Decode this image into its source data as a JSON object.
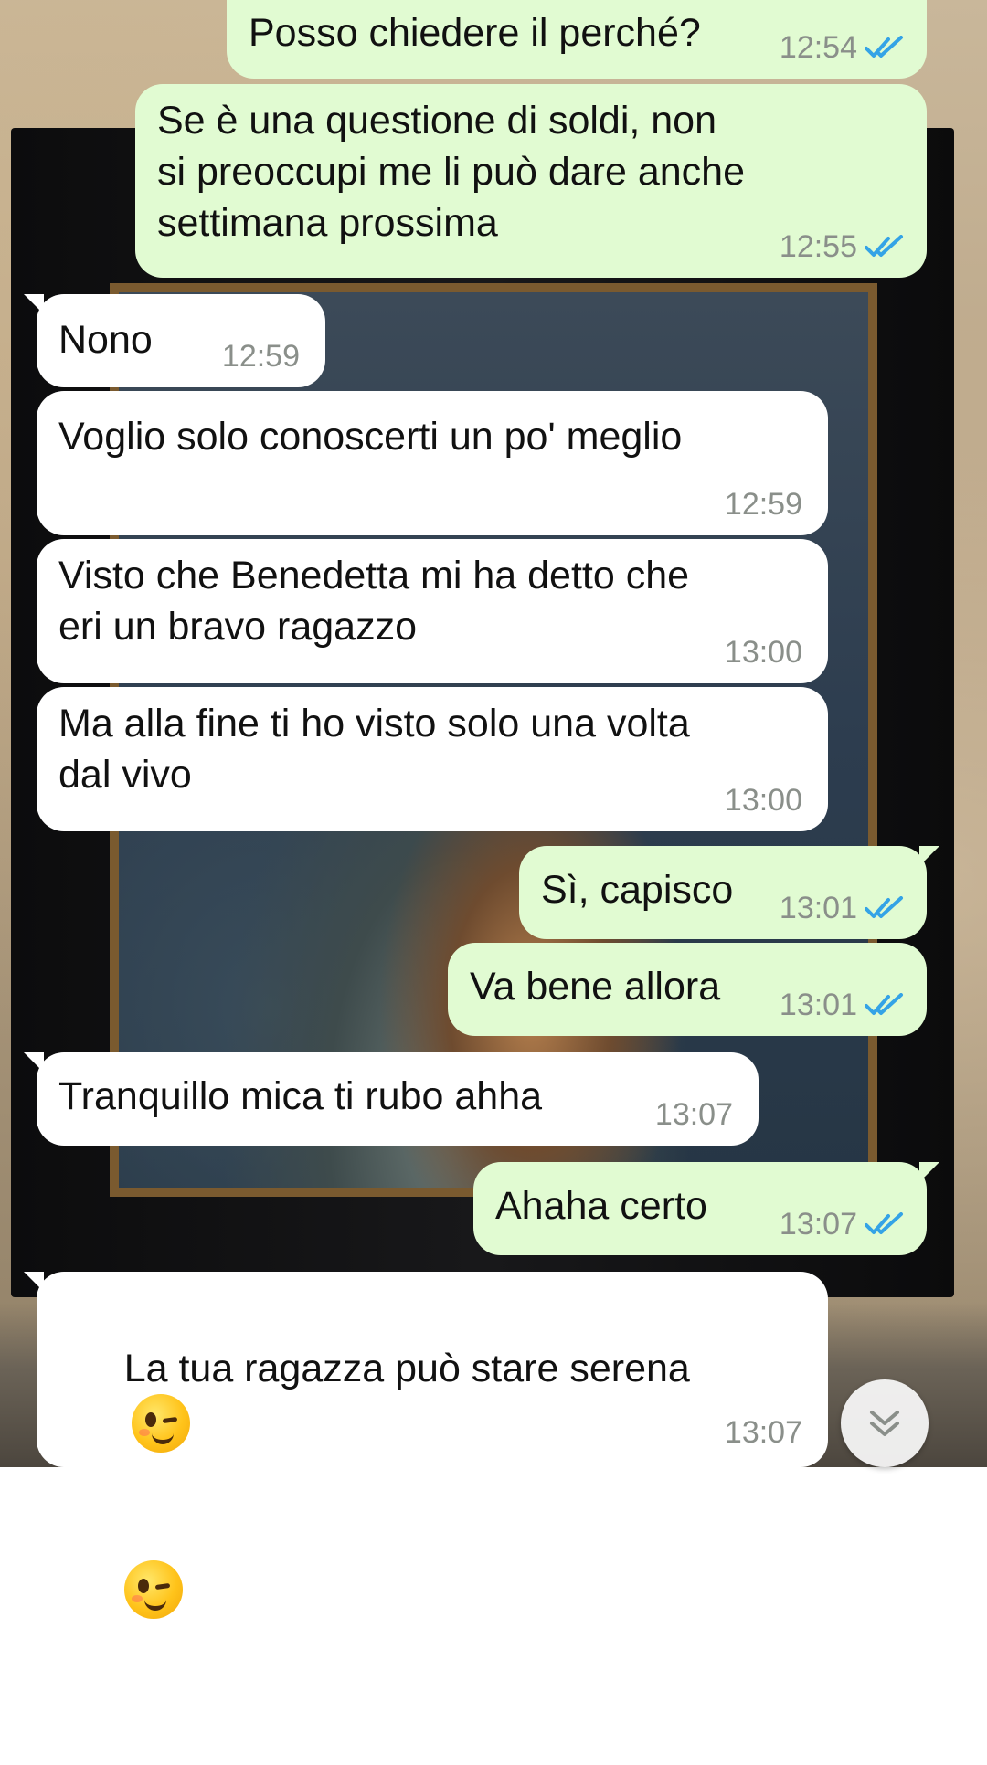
{
  "messages": [
    {
      "direction": "out",
      "text": "Posso chiedere il perché?",
      "time": "12:54",
      "read": true
    },
    {
      "direction": "out",
      "text": "Se è una questione di soldi, non\nsi preoccupi me li può dare anche\nsettimana prossima",
      "time": "12:55",
      "read": true
    },
    {
      "direction": "in",
      "text": "Nono",
      "time": "12:59"
    },
    {
      "direction": "in",
      "text": "Voglio solo conoscerti un po' meglio",
      "time": "12:59"
    },
    {
      "direction": "in",
      "text": "Visto che Benedetta mi ha detto che\neri un bravo ragazzo",
      "time": "13:00"
    },
    {
      "direction": "in",
      "text": "Ma alla fine ti ho visto solo una volta\ndal vivo",
      "time": "13:00"
    },
    {
      "direction": "out",
      "text": "Sì, capisco",
      "time": "13:01",
      "read": true
    },
    {
      "direction": "out",
      "text": "Va bene allora",
      "time": "13:01",
      "read": true
    },
    {
      "direction": "in",
      "text": "Tranquillo mica ti rubo ahha",
      "time": "13:07"
    },
    {
      "direction": "out",
      "text": "Ahaha certo",
      "time": "13:07",
      "read": true
    },
    {
      "direction": "in",
      "text": "La tua ragazza può stare serena",
      "emoji": [
        "winking-face",
        "winking-face"
      ],
      "time": "13:07"
    }
  ],
  "colors": {
    "outgoing_bubble": "#e1fbd2",
    "incoming_bubble": "#ffffff",
    "read_ticks": "#34a3e6",
    "timestamp": "#8a8f8a"
  },
  "icons": {
    "read_receipt": "double-check-icon",
    "scroll_down": "chevron-double-down-icon"
  }
}
